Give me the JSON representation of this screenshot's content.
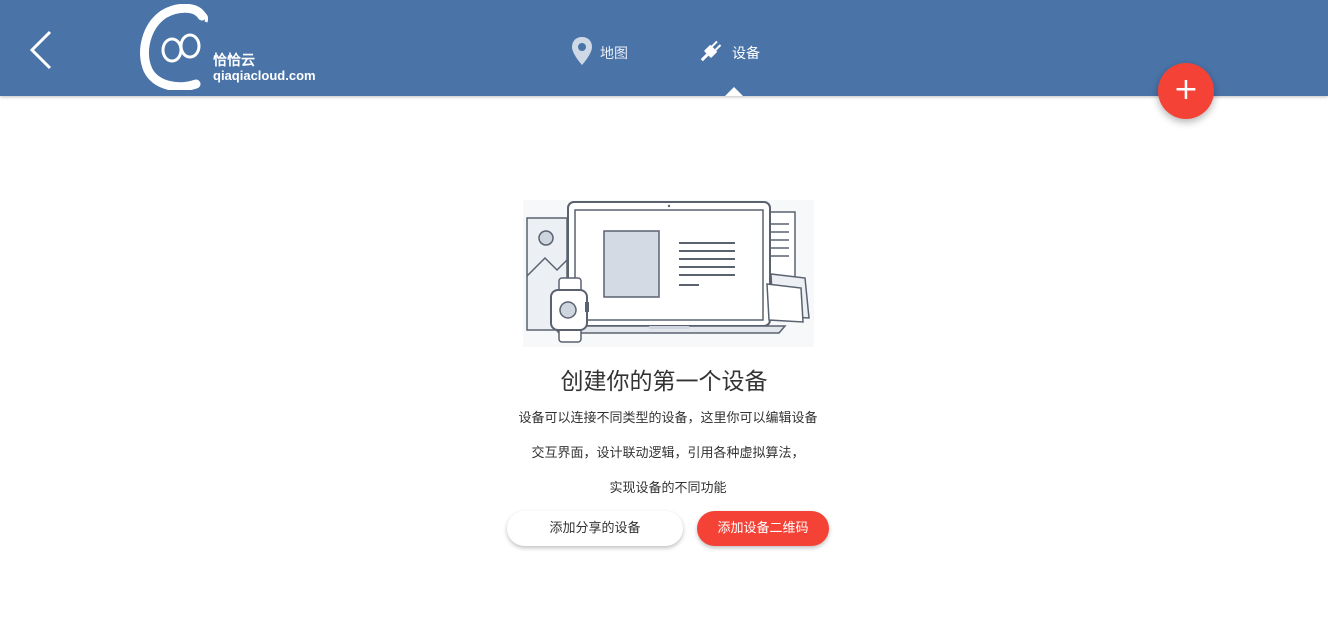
{
  "header": {
    "logo_cn": "恰恰云",
    "logo_url": "qiaqiacloud.com",
    "tabs": [
      {
        "label": "地图",
        "icon": "map-pin-icon"
      },
      {
        "label": "设备",
        "icon": "plug-icon",
        "active": true
      }
    ],
    "fab_label": "+"
  },
  "empty_state": {
    "title": "创建你的第一个设备",
    "lines": [
      "设备可以连接不同类型的设备，这里你可以编辑设备",
      "交互界面，设计联动逻辑，引用各种虚拟算法，",
      "实现设备的不同功能"
    ],
    "buttons": {
      "shared": "添加分享的设备",
      "qrcode": "添加设备二维码"
    }
  },
  "colors": {
    "header_bg": "#4a73a8",
    "accent": "#f44336"
  }
}
